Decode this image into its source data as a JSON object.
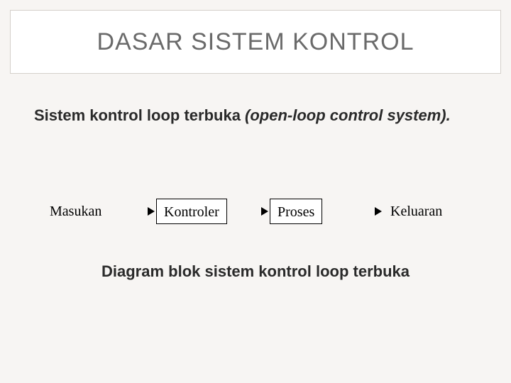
{
  "title": "DASAR SISTEM KONTROL",
  "subtitle": {
    "main": "Sistem kontrol loop terbuka ",
    "italic": "(open-loop control system)."
  },
  "diagram": {
    "nodes": {
      "input": "Masukan",
      "controller": "Kontroler",
      "process": "Proses",
      "output": "Keluaran"
    }
  },
  "caption": "Diagram blok sistem kontrol loop terbuka"
}
